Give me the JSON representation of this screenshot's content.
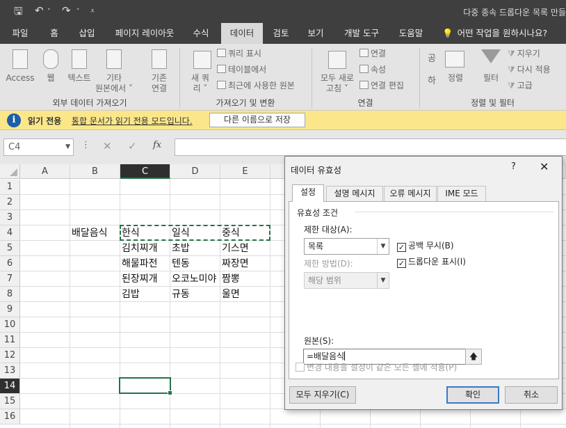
{
  "titlebar": {
    "title": "다중 종속 드롭다운 목록 만들"
  },
  "tabs": [
    "파일",
    "홈",
    "삽입",
    "페이지 레이아웃",
    "수식",
    "데이터",
    "검토",
    "보기",
    "개발 도구",
    "도움말"
  ],
  "active_tab": "데이터",
  "tell_me": "어떤 작업을 원하시나요?",
  "ribbon": {
    "access": "Access",
    "web": "웹",
    "text": "텍스트",
    "other_1": "기타",
    "other_2": "원본에서 ˅",
    "existing_1": "기존",
    "existing_2": "연결",
    "new_query_1": "새 쿼",
    "new_query_2": "리 ˅",
    "show_queries": "쿼리 표시",
    "from_table": "테이블에서",
    "recent_sources": "최근에 사용한 원본",
    "refresh_1": "모두 새로",
    "refresh_2": "고침 ˅",
    "connections": "연결",
    "properties": "속성",
    "edit_links": "연결 편집",
    "sort_az_1": "공",
    "sort_az_2": "하",
    "sort": "정렬",
    "filter": "필터",
    "clear": "지우기",
    "reapply": "다시 적용",
    "advanced": "고급",
    "group_external": "외부 데이터 가져오기",
    "group_get": "가져오기 및 변환",
    "group_connections": "연결",
    "group_sort_filter": "정렬 및 필터"
  },
  "message_bar": {
    "label": "읽기 전용",
    "text": "통합 문서가 읽기 전용 모드입니다.",
    "button": "다른 이름으로 저장"
  },
  "formula_bar": {
    "name_box": "C4",
    "fx": "fx"
  },
  "grid": {
    "columns": [
      "A",
      "B",
      "C",
      "D",
      "E"
    ],
    "selected_column": "C",
    "rows": [
      "1",
      "2",
      "3",
      "4",
      "5",
      "6",
      "7",
      "8",
      "9",
      "10",
      "11",
      "12",
      "13",
      "14",
      "15",
      "16"
    ],
    "selected_row": "14",
    "cells": {
      "B4": "배달음식",
      "C4": "한식",
      "D4": "일식",
      "E4": "중식",
      "C5": "김치찌개",
      "D5": "초밥",
      "E5": "기스면",
      "C6": "해물파전",
      "D6": "텐동",
      "E6": "짜장면",
      "C7": "된장찌개",
      "D7": "오코노미야",
      "E7": "짬뽕",
      "C8": "김밥",
      "D8": "규동",
      "E8": "울면"
    }
  },
  "dialog": {
    "title": "데이터 유효성",
    "help": "?",
    "close": "✕",
    "tabs": [
      "설정",
      "설명 메시지",
      "오류 메시지",
      "IME 모드"
    ],
    "criteria_header": "유효성 조건",
    "allow_label": "제한 대상(A):",
    "allow_value": "목록",
    "data_label": "제한 방법(D):",
    "data_value": "해당 범위",
    "ignore_blank": "공백 무시(B)",
    "in_cell_dropdown": "드롭다운 표시(I)",
    "source_label": "원본(S):",
    "source_value": "=배달음식",
    "apply_all": "변경 내용을 설정이 같은 모든 셀에 적용(P)",
    "clear_all": "모두 지우기(C)",
    "ok": "확인",
    "cancel": "취소"
  }
}
